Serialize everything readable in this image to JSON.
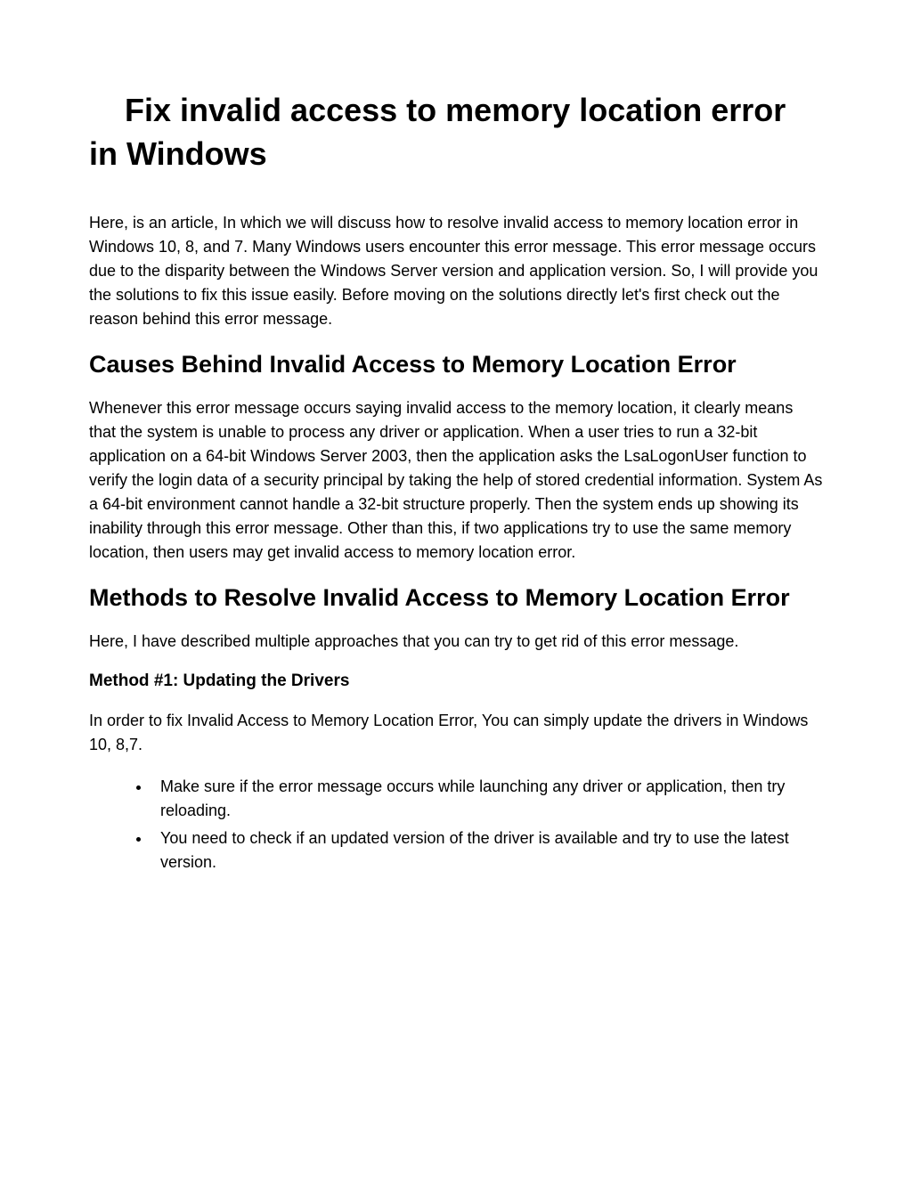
{
  "title": "Fix invalid access to memory location error in Windows",
  "intro": "Here, is an article, In which we will discuss how to resolve invalid access to memory location error in Windows 10, 8, and 7. Many Windows users encounter this error message. This error message occurs due to the disparity between the Windows Server version and application version. So, I will provide you the solutions to fix this issue easily. Before moving on the solutions directly let's first check out the reason behind this error message.",
  "causes_heading": "Causes Behind Invalid Access to Memory Location Error",
  "causes_body": "Whenever this error message occurs saying invalid access to the memory location, it clearly means that the system is unable to process any driver or application. When a user tries to run a 32-bit application on a 64-bit Windows Server 2003, then the application asks the LsaLogonUser function to verify the login data of a security principal by taking the help of stored credential information. System As a 64-bit environment cannot handle a 32-bit structure properly. Then the system ends up showing its inability through this error message. Other than this, if two applications try to use the same memory location, then users may get invalid access to memory location error.",
  "methods_heading": "Methods to Resolve Invalid Access to Memory Location Error",
  "methods_intro": "Here, I have described multiple approaches that you can try to get rid of this error message.",
  "method1_heading": "Method #1: Updating the Drivers",
  "method1_intro": " In order to fix Invalid Access to Memory Location Error, You can simply update the drivers in Windows 10, 8,7.",
  "method1_items": [
    "Make sure if the error message occurs while launching any driver or application, then try reloading.",
    "You need to check if an updated version of the driver is available and try to use the latest version."
  ]
}
